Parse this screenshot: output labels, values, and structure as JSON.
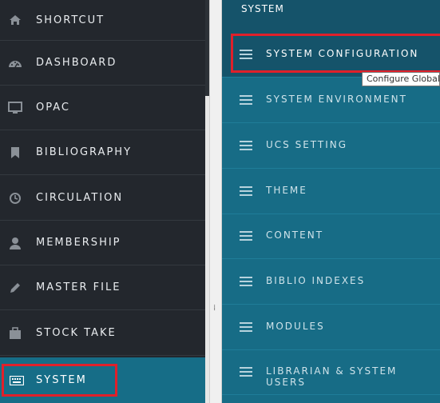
{
  "sidebar": {
    "items": [
      {
        "label": "SHORTCUT",
        "icon": "home-icon"
      },
      {
        "label": "DASHBOARD",
        "icon": "dashboard-gauge-icon"
      },
      {
        "label": "OPAC",
        "icon": "monitor-icon"
      },
      {
        "label": "BIBLIOGRAPHY",
        "icon": "bookmark-icon"
      },
      {
        "label": "CIRCULATION",
        "icon": "clock-icon"
      },
      {
        "label": "MEMBERSHIP",
        "icon": "user-icon"
      },
      {
        "label": "MASTER FILE",
        "icon": "pencil-icon"
      },
      {
        "label": "STOCK TAKE",
        "icon": "briefcase-icon"
      },
      {
        "label": "SYSTEM",
        "icon": "keyboard-icon",
        "active": true
      }
    ]
  },
  "submenu": {
    "title": "SYSTEM",
    "items": [
      {
        "label": "SYSTEM CONFIGURATION",
        "active": true
      },
      {
        "label": "SYSTEM ENVIRONMENT"
      },
      {
        "label": "UCS SETTING"
      },
      {
        "label": "THEME"
      },
      {
        "label": "CONTENT"
      },
      {
        "label": "BIBLIO INDEXES"
      },
      {
        "label": "MODULES"
      },
      {
        "label": "LIBRARIAN & SYSTEM USERS"
      }
    ]
  },
  "tooltip": {
    "text": "Configure Global"
  },
  "colors": {
    "sidebar_bg": "#23272d",
    "active_teal": "#166d87",
    "submenu_bg": "#176c86",
    "submenu_header_bg": "#15536a",
    "highlight_red": "#e0202a"
  }
}
